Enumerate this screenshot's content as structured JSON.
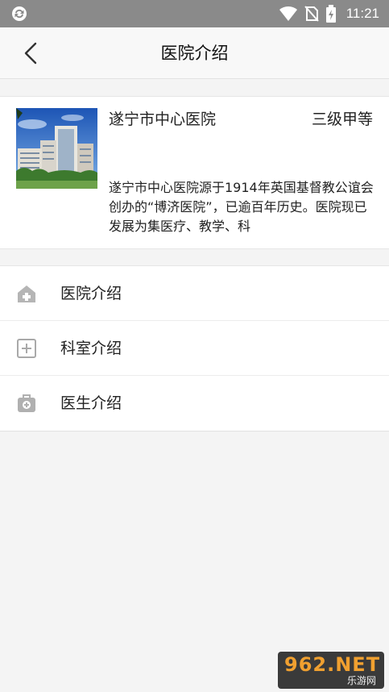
{
  "status_bar": {
    "time": "11:21",
    "icons": [
      "sync-icon",
      "wifi-icon",
      "no-sim-icon",
      "battery-charging-icon"
    ]
  },
  "app_bar": {
    "title": "医院介绍",
    "back_icon": "chevron-left-icon"
  },
  "hospital": {
    "name": "遂宁市中心医院",
    "grade": "三级甲等",
    "description": "遂宁市中心医院源于1914年英国基督教公谊会创办的“博济医院”，已逾百年历史。医院现已发展为集医疗、教学、科"
  },
  "menu": {
    "items": [
      {
        "label": "医院介绍",
        "icon": "hospital-icon"
      },
      {
        "label": "科室介绍",
        "icon": "plus-square-icon"
      },
      {
        "label": "医生介绍",
        "icon": "medical-bag-icon"
      }
    ]
  },
  "watermark": {
    "logo": "962.NET",
    "sub": "乐游网"
  },
  "colors": {
    "status_bar": "#8a8a8a",
    "background": "#f4f4f4",
    "icon_gray": "#9a9a9a"
  }
}
